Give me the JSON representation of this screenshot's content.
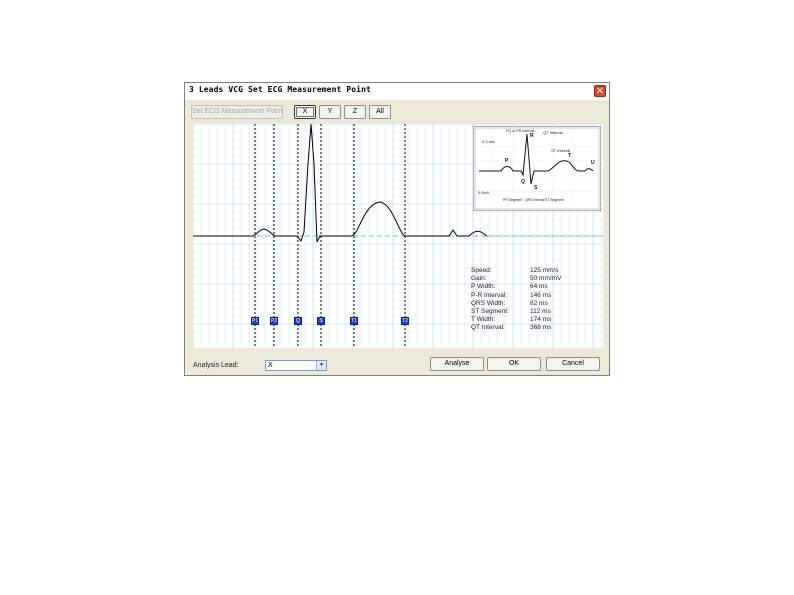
{
  "window": {
    "title": "3 Leads VCG Set ECG Measurement Point",
    "close_glyph": "✕"
  },
  "toolbar": {
    "set_point_label": "Set ECG Measurement Point",
    "lead_buttons": [
      "X",
      "Y",
      "Z",
      "All"
    ],
    "active_lead": "X"
  },
  "markers": [
    "P1",
    "P2",
    "Q",
    "S",
    "T1",
    "T2"
  ],
  "diagram": {
    "labels": {
      "pr_interval": "PQ or PR Interval",
      "qt_interval": "QT Interval",
      "st_interval": "ST Interval",
      "time_scale": "0.2 sec",
      "amp_scale": "0.5mV",
      "p": "P",
      "q": "Q",
      "r": "R",
      "s": "S",
      "t": "T",
      "u": "U",
      "pr_segment": "PR Segment",
      "qrs_interval": "QRS Interval",
      "st_segment": "ST Segment"
    }
  },
  "measurements": [
    {
      "label": "Speed:",
      "value": "125 mm/s"
    },
    {
      "label": "Gain:",
      "value": "50 mm/mV"
    },
    {
      "label": "P Width:",
      "value": "64 ms"
    },
    {
      "label": "P-R Interval:",
      "value": "146 ms"
    },
    {
      "label": "QRS Width:",
      "value": "82 ms"
    },
    {
      "label": "ST Segment:",
      "value": "112 ms"
    },
    {
      "label": "T Width:",
      "value": "174 ms"
    },
    {
      "label": "QT Interval:",
      "value": "368 ms"
    }
  ],
  "footer": {
    "analysis_lead_label": "Analysis Lead:",
    "analysis_lead_value": "X",
    "analyse_label": "Analyse",
    "ok_label": "OK",
    "cancel_label": "Cancel"
  },
  "colors": {
    "grid_minor": "#d3ecf7",
    "grid_major": "#a9d3ea",
    "baseline": "#66c3dd",
    "trace": "#000000",
    "marker": "#1e3fd0"
  }
}
